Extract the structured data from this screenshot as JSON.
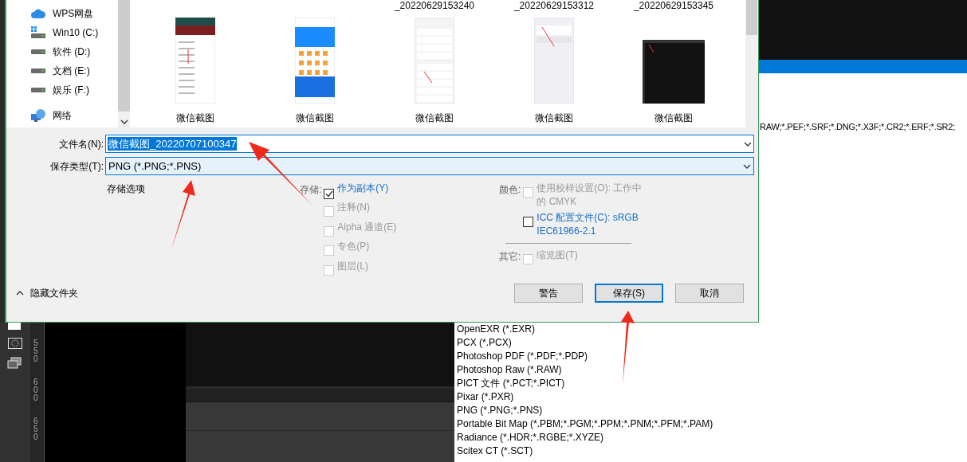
{
  "dialog": {
    "sidebar": {
      "items": [
        {
          "label": "WPS网盘",
          "kind": "cloud"
        },
        {
          "label": "Win10 (C:)",
          "kind": "system-drive"
        },
        {
          "label": "软件 (D:)",
          "kind": "drive"
        },
        {
          "label": "文档 (E:)",
          "kind": "drive"
        },
        {
          "label": "娱乐 (F:)",
          "kind": "drive"
        },
        {
          "label": "网络",
          "kind": "network"
        }
      ]
    },
    "files": [
      {
        "caption": "微信截图",
        "kind": "red-header"
      },
      {
        "caption": "微信截图",
        "kind": "blue-app"
      },
      {
        "caption": "微信截图",
        "kind": "settings",
        "previous_row_tail": "_20220629153240"
      },
      {
        "caption": "微信截图",
        "kind": "sparse",
        "previous_row_tail": "_20220629153312"
      },
      {
        "caption": "微信截图",
        "kind": "dark",
        "previous_row_tail": "_20220629153345"
      }
    ],
    "file_name": {
      "label": "文件名(N):",
      "value": "微信截图_20220707100347",
      "selected": true
    },
    "file_type": {
      "label": "保存类型(T):",
      "value": "PNG (*.PNG;*.PNS)"
    },
    "options": {
      "title": "存储选项",
      "storage": {
        "label": "存储:",
        "items": [
          {
            "label": "作为副本(Y)",
            "checked": true,
            "disabled": false
          },
          {
            "label": "注释(N)",
            "checked": false,
            "disabled": true
          },
          {
            "label": "Alpha 通道(E)",
            "checked": false,
            "disabled": true
          },
          {
            "label": "专色(P)",
            "checked": false,
            "disabled": true
          },
          {
            "label": "图层(L)",
            "checked": false,
            "disabled": true
          }
        ]
      },
      "color": {
        "label": "颜色:",
        "items": [
          {
            "label": "使用校样设置(O): 工作中的 CMYK",
            "checked": false,
            "disabled": true
          },
          {
            "label": "ICC 配置文件(C): sRGB IEC61966-2.1",
            "checked": false,
            "disabled": false
          }
        ]
      },
      "other": {
        "label": "其它:",
        "items": [
          {
            "label": "缩览图(T)",
            "checked": false,
            "disabled": true
          }
        ]
      }
    },
    "hide_folders": "隐藏文件夹",
    "buttons": [
      {
        "label": "警告",
        "default": false
      },
      {
        "label": "保存(S)",
        "default": true
      },
      {
        "label": "取消",
        "default": false
      }
    ]
  },
  "type_list": {
    "partial_item": "RAW;*.PEF;*.SRF;*.DNG;*.X3F;*.CR2;*.ERF;*.SR2;",
    "items": [
      "OpenEXR (*.EXR)",
      "PCX (*.PCX)",
      "Photoshop PDF (*.PDF;*.PDP)",
      "Photoshop Raw (*.RAW)",
      "PICT 文件 (*.PCT;*.PICT)",
      "Pixar (*.PXR)",
      "PNG (*.PNG;*.PNS)",
      "Portable Bit Map (*.PBM;*.PGM;*.PPM;*.PNM;*.PFM;*.PAM)",
      "Radiance (*.HDR;*.RGBE;*.XYZE)",
      "Scitex CT (*.SCT)"
    ]
  },
  "ruler": {
    "marks": [
      "550",
      "600",
      "650"
    ]
  }
}
